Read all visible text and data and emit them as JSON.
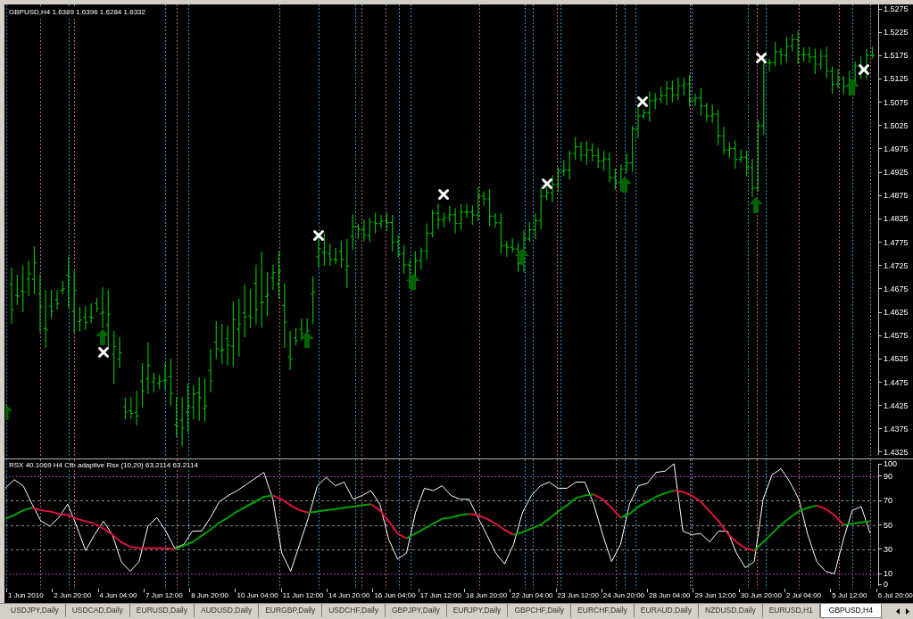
{
  "price_chart": {
    "title": "GBPUSD,H4 1.6389 1.6396 1.6284 1.6332",
    "price_axis": [
      "1.5275",
      "1.5225",
      "1.5175",
      "1.5125",
      "1.5075",
      "1.5025",
      "1.4975",
      "1.4925",
      "1.4875",
      "1.4825",
      "1.4775",
      "1.4725",
      "1.4675",
      "1.4625",
      "1.4575",
      "1.4525",
      "1.4475",
      "1.4425",
      "1.4375",
      "1.4325"
    ]
  },
  "indicator": {
    "title": "RSX 40.1069 H4 Cfb adaptive Rsx (10,20) 63.2114 63.2114",
    "chart_data": {
      "type": "line",
      "ylim": [
        0,
        100
      ],
      "yticks": [
        0,
        10,
        30,
        50,
        70,
        90,
        100
      ],
      "grid": true,
      "series": [
        {
          "color": "#ffffff",
          "values": [
            80,
            87,
            82,
            67,
            53,
            49,
            56,
            67,
            49,
            29,
            42,
            53,
            42,
            20,
            12,
            20,
            49,
            56,
            45,
            31,
            34,
            45,
            45,
            56,
            69,
            74,
            78,
            83,
            88,
            93,
            71,
            27,
            12,
            34,
            56,
            82,
            89,
            82,
            85,
            71,
            74,
            78,
            67,
            38,
            22,
            27,
            60,
            80,
            78,
            82,
            74,
            71,
            71,
            56,
            42,
            27,
            18,
            34,
            60,
            74,
            82,
            85,
            80,
            80,
            85,
            85,
            67,
            42,
            20,
            34,
            67,
            82,
            84,
            93,
            94,
            100,
            45,
            42,
            43,
            36,
            45,
            45,
            27,
            15,
            20,
            71,
            91,
            96,
            85,
            71,
            42,
            20,
            12,
            10,
            38,
            62,
            65,
            43
          ]
        },
        {
          "color": "#00a000",
          "values": [
            55,
            58,
            62,
            64,
            null,
            null,
            null,
            null,
            null,
            null,
            null,
            null,
            null,
            null,
            null,
            null,
            null,
            null,
            null,
            30,
            33,
            36,
            41,
            46,
            52,
            56,
            61,
            65,
            69,
            73,
            74,
            null,
            null,
            null,
            60,
            61,
            62,
            63,
            64,
            65,
            66,
            67,
            null,
            null,
            null,
            39,
            43,
            47,
            51,
            55,
            56,
            58,
            59,
            null,
            null,
            null,
            null,
            42,
            44,
            47,
            50,
            55,
            61,
            66,
            72,
            74,
            75,
            null,
            null,
            56,
            59,
            65,
            69,
            73,
            76,
            78,
            null,
            null,
            null,
            null,
            null,
            null,
            null,
            null,
            29,
            36,
            43,
            50,
            56,
            61,
            64,
            66,
            null,
            null,
            50,
            51,
            52,
            53
          ]
        },
        {
          "color": "#dc143c",
          "values": [
            null,
            null,
            null,
            64,
            62,
            61,
            59,
            58,
            55,
            53,
            51,
            47,
            42,
            36,
            32,
            31,
            31,
            31,
            31,
            30,
            null,
            null,
            null,
            null,
            null,
            null,
            null,
            null,
            null,
            null,
            74,
            71,
            66,
            62,
            60,
            null,
            null,
            null,
            null,
            null,
            null,
            67,
            62,
            53,
            43,
            39,
            null,
            null,
            null,
            null,
            null,
            null,
            59,
            58,
            55,
            51,
            46,
            42,
            null,
            null,
            null,
            null,
            null,
            null,
            null,
            null,
            75,
            71,
            64,
            56,
            null,
            null,
            null,
            null,
            null,
            78,
            77,
            74,
            69,
            61,
            53,
            43,
            36,
            31,
            29,
            null,
            null,
            null,
            null,
            null,
            null,
            66,
            63,
            58,
            50,
            null,
            null,
            null
          ]
        }
      ]
    }
  },
  "time_axis": [
    "1 Jun 2010",
    "2 Jun 20:00",
    "4 Jun 04:00",
    "7 Jun 12:00",
    "8 Jun 20:00",
    "10 Jun 04:00",
    "11 Jun 12:00",
    "14 Jun 20:00",
    "16 Jun 04:00",
    "17 Jun 12:00",
    "18 Jun 20:00",
    "22 Jun 04:00",
    "23 Jun 12:00",
    "24 Jun 20:00",
    "28 Jun 04:00",
    "29 Jun 12:00",
    "30 Jun 20:00",
    "2 Jul 04:00",
    "5 Jul 12:00",
    "6 Jul 20:00"
  ],
  "tabs": [
    {
      "label": "USDJPY,Daily",
      "selected": false
    },
    {
      "label": "USDCAD,Daily",
      "selected": false
    },
    {
      "label": "EURUSD,Daily",
      "selected": false
    },
    {
      "label": "AUDUSD,Daily",
      "selected": false
    },
    {
      "label": "EURGBP,Daily",
      "selected": false
    },
    {
      "label": "USDCHF,Daily",
      "selected": false
    },
    {
      "label": "GBPJPY,Daily",
      "selected": false
    },
    {
      "label": "EURJPY,Daily",
      "selected": false
    },
    {
      "label": "GBPCHF,Daily",
      "selected": false
    },
    {
      "label": "EURCHF,Daily",
      "selected": false
    },
    {
      "label": "EURAUD,Daily",
      "selected": false
    },
    {
      "label": "NZDUSD,Daily",
      "selected": false
    },
    {
      "label": "EURUSD,H1",
      "selected": false
    },
    {
      "label": "GBPUSD,H4",
      "selected": true
    }
  ]
}
